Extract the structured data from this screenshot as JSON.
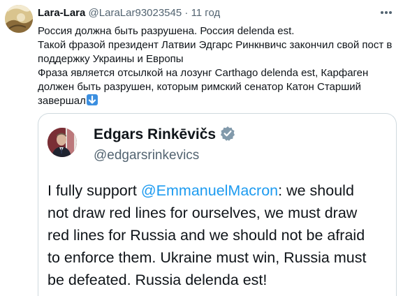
{
  "post": {
    "author_name": "Lara-Lara",
    "author_handle": "@LaraLar93023545",
    "separator": "·",
    "timestamp": "11 год",
    "text_lines": [
      "Россия должна быть разрушена. Россия delenda est.",
      "Такой фразой президент Латвии Эдгарс Ринкнвичс закончил свой пост в",
      "поддержку Украины и Европы",
      "Фраза является отсылкой на лозунг Carthago delenda est, Карфаген",
      "должен быть разрушен, которым римский сенатор Катон Старший",
      "завершал"
    ]
  },
  "icons": {
    "more": "more-icon",
    "down_arrow": "down-arrow-emoji-icon",
    "verified": "verified-badge-icon"
  },
  "embed": {
    "author_name": "Edgars Rinkēvičs",
    "author_handle": "@edgarsrinkevics",
    "text_prefix": "I fully support ",
    "mention": "@EmmanuelMacron",
    "text_after_mention": ": we should",
    "text_lines": [
      "not draw red lines for ourselves, we must draw",
      "red lines for Russia and we should not be afraid",
      "to enforce them. Ukraine must win, Russia must",
      "be defeated. Russia delenda est!"
    ]
  },
  "colors": {
    "text": "#0f1419",
    "secondary": "#536471",
    "link": "#1d9bf0",
    "border": "#cfd9de",
    "arrow_emoji": "#3c8fe0"
  }
}
